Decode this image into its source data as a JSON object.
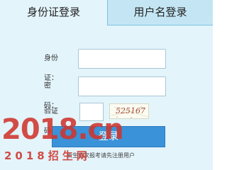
{
  "tabs": [
    {
      "label": "身份证登录",
      "active": true
    },
    {
      "label": "用户名登录",
      "active": false
    }
  ],
  "form": {
    "id_label": "身份证：",
    "id_value": "",
    "password_label": "密　码：",
    "password_value": "",
    "captcha_label": "验证码：",
    "captcha_value": "",
    "captcha_text": "525167"
  },
  "submit_label": "登录",
  "register_hint": "新生首次报考请先注册用户",
  "watermark": {
    "logo": "2018.cn",
    "tagline": "2018招生网"
  },
  "colors": {
    "panel_background": "#e3f4fb",
    "inactive_tab": "#c4e6f4",
    "border": "#7cc4e0",
    "button": "#3a92d8",
    "watermark": "#ce342c",
    "captcha_text": "#a84a3a"
  }
}
